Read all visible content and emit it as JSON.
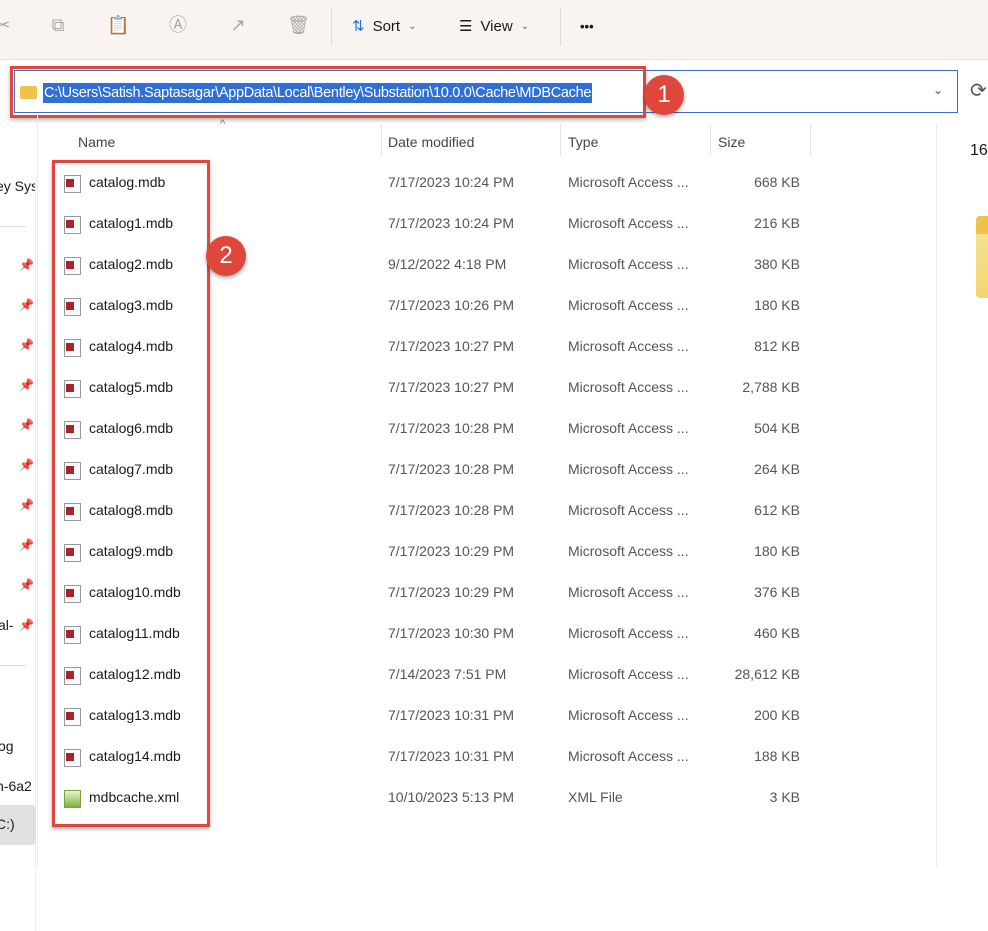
{
  "toolbar": {
    "sort_label": "Sort",
    "view_label": "View",
    "more_label": "•••"
  },
  "address": {
    "path": "C:\\Users\\Satish.Saptasagar\\AppData\\Local\\Bentley\\Substation\\10.0.0\\Cache\\MDBCache"
  },
  "annotations": {
    "badge1": "1",
    "badge2": "2"
  },
  "columns": {
    "name": "Name",
    "date": "Date modified",
    "type": "Type",
    "size": "Size"
  },
  "sidebar": {
    "items": [
      "ey Sys",
      "al-",
      "og",
      "n-6a2",
      "C:)"
    ]
  },
  "details_pane": {
    "count": "16"
  },
  "files": [
    {
      "name": "catalog.mdb",
      "date": "7/17/2023 10:24 PM",
      "type": "Microsoft Access ...",
      "size": "668 KB",
      "icon": "access-file-icon"
    },
    {
      "name": "catalog1.mdb",
      "date": "7/17/2023 10:24 PM",
      "type": "Microsoft Access ...",
      "size": "216 KB",
      "icon": "access-file-icon"
    },
    {
      "name": "catalog2.mdb",
      "date": "9/12/2022 4:18 PM",
      "type": "Microsoft Access ...",
      "size": "380 KB",
      "icon": "access-file-icon"
    },
    {
      "name": "catalog3.mdb",
      "date": "7/17/2023 10:26 PM",
      "type": "Microsoft Access ...",
      "size": "180 KB",
      "icon": "access-file-icon"
    },
    {
      "name": "catalog4.mdb",
      "date": "7/17/2023 10:27 PM",
      "type": "Microsoft Access ...",
      "size": "812 KB",
      "icon": "access-file-icon"
    },
    {
      "name": "catalog5.mdb",
      "date": "7/17/2023 10:27 PM",
      "type": "Microsoft Access ...",
      "size": "2,788 KB",
      "icon": "access-file-icon"
    },
    {
      "name": "catalog6.mdb",
      "date": "7/17/2023 10:28 PM",
      "type": "Microsoft Access ...",
      "size": "504 KB",
      "icon": "access-file-icon"
    },
    {
      "name": "catalog7.mdb",
      "date": "7/17/2023 10:28 PM",
      "type": "Microsoft Access ...",
      "size": "264 KB",
      "icon": "access-file-icon"
    },
    {
      "name": "catalog8.mdb",
      "date": "7/17/2023 10:28 PM",
      "type": "Microsoft Access ...",
      "size": "612 KB",
      "icon": "access-file-icon"
    },
    {
      "name": "catalog9.mdb",
      "date": "7/17/2023 10:29 PM",
      "type": "Microsoft Access ...",
      "size": "180 KB",
      "icon": "access-file-icon"
    },
    {
      "name": "catalog10.mdb",
      "date": "7/17/2023 10:29 PM",
      "type": "Microsoft Access ...",
      "size": "376 KB",
      "icon": "access-file-icon"
    },
    {
      "name": "catalog11.mdb",
      "date": "7/17/2023 10:30 PM",
      "type": "Microsoft Access ...",
      "size": "460 KB",
      "icon": "access-file-icon"
    },
    {
      "name": "catalog12.mdb",
      "date": "7/14/2023 7:51 PM",
      "type": "Microsoft Access ...",
      "size": "28,612 KB",
      "icon": "access-file-icon"
    },
    {
      "name": "catalog13.mdb",
      "date": "7/17/2023 10:31 PM",
      "type": "Microsoft Access ...",
      "size": "200 KB",
      "icon": "access-file-icon"
    },
    {
      "name": "catalog14.mdb",
      "date": "7/17/2023 10:31 PM",
      "type": "Microsoft Access ...",
      "size": "188 KB",
      "icon": "access-file-icon"
    },
    {
      "name": "mdbcache.xml",
      "date": "10/10/2023 5:13 PM",
      "type": "XML File",
      "size": "3 KB",
      "icon": "xml-file-icon"
    }
  ]
}
